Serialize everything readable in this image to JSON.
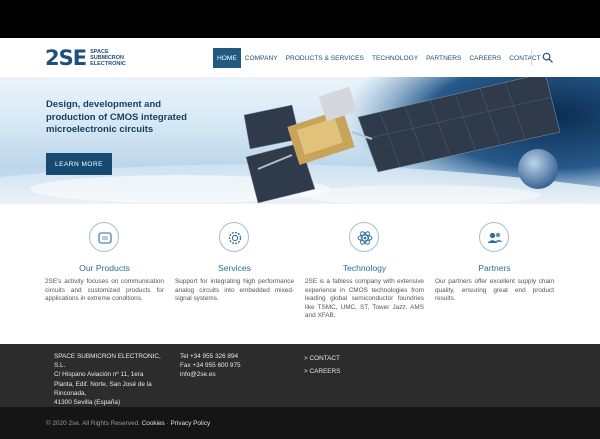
{
  "header": {
    "logo": {
      "mark": "2SE",
      "line1": "SPACE",
      "line2": "SUBMICRON",
      "line3": "ELECTRONIC"
    },
    "nav": [
      {
        "label": "HOME",
        "active": true
      },
      {
        "label": "COMPANY"
      },
      {
        "label": "PRODUCTS & SERVICES"
      },
      {
        "label": "TECHNOLOGY"
      },
      {
        "label": "PARTNERS"
      },
      {
        "label": "CAREERS"
      },
      {
        "label": "CONTACT"
      }
    ],
    "search_icon": "search-icon"
  },
  "hero": {
    "title": "Design, development and production of CMOS integrated microelectronic circuits",
    "button": "LEARN MORE"
  },
  "features": [
    {
      "icon": "chip-icon",
      "title": "Our Products",
      "text": "2SE's activity focuses on communication circuits and customized products for applications in extreme conditions."
    },
    {
      "icon": "gear-icon",
      "title": "Services",
      "text": "Support for integrating high performance analog circuits into embedded mixed-signal systems."
    },
    {
      "icon": "atom-icon",
      "title": "Technology",
      "text": "2SE is a fabless company with extensive experience in CMOS technologies from leading global semiconductor foundries like TSMC, UMC, ST, Tower Jazz, AMS and XFAB."
    },
    {
      "icon": "users-icon",
      "title": "Partners",
      "text": "Our partners offer excellent supply chain quality, ensuring great end product results."
    }
  ],
  "footer": {
    "address": [
      "SPACE SUBMICRON ELECTRONIC, S.L.",
      "C/ Hispano Aviación nº 11, 1era",
      "Planta, Edif. Norte, San José de la",
      "Rinconada,",
      "41300 Sevilla (España)"
    ],
    "contact": [
      "Tel +34 955 326 894",
      "Fax +34 955 600 975",
      "info@2se.es"
    ],
    "links": [
      "> CONTACT",
      "> CAREERS"
    ],
    "copyright": "© 2020 2se. All Rights Reserved.",
    "cookies": "Cookies",
    "separator": " · ",
    "privacy": "Privacy Policy"
  },
  "colors": {
    "primary": "#1f5a80",
    "title_blue": "#2a6d96",
    "footer_bg": "#2c2c2c",
    "bottom_bg": "#151515"
  }
}
